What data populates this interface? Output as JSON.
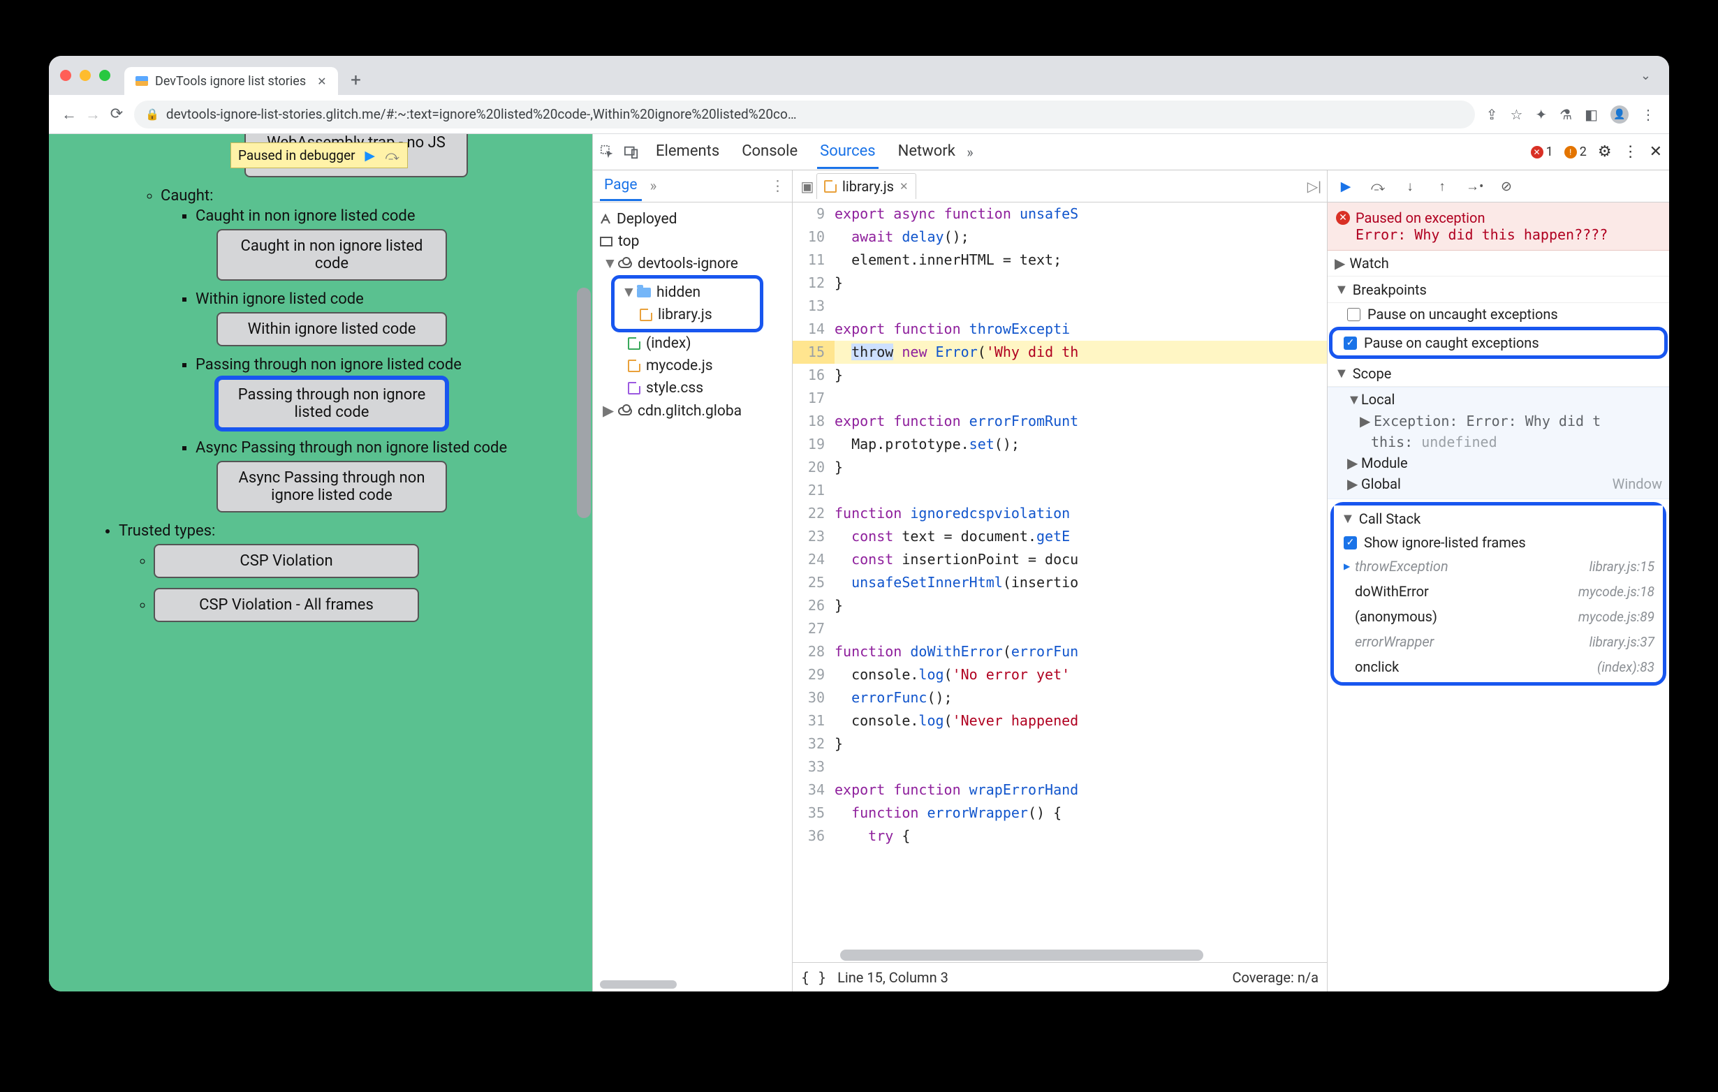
{
  "window": {
    "tab_title": "DevTools ignore list stories",
    "url": "devtools-ignore-list-stories.glitch.me/#:~:text=ignore%20listed%20code-,Within%20ignore%20listed%20co…"
  },
  "paused_overlay": {
    "label": "Paused in debugger"
  },
  "page": {
    "top_button": "WebAssembly trap - no JS frames",
    "caught_label": "Caught:",
    "items": [
      {
        "label": "Caught in non ignore listed code",
        "button": "Caught in non ignore listed code",
        "hi": false
      },
      {
        "label": "Within ignore listed code",
        "button": "Within ignore listed code",
        "hi": false
      },
      {
        "label": "Passing through non ignore listed code",
        "button": "Passing through non ignore listed code",
        "hi": true
      },
      {
        "label": "Async Passing through non ignore listed code",
        "button": "Async Passing through non ignore listed code",
        "hi": false
      }
    ],
    "trusted_label": "Trusted types:",
    "trusted_buttons": [
      "CSP Violation",
      "CSP Violation - All frames"
    ]
  },
  "devtools": {
    "tabs": [
      "Elements",
      "Console",
      "Sources",
      "Network"
    ],
    "active_tab": "Sources",
    "errors": 1,
    "warnings": 2,
    "page_tab": "Page",
    "tree": {
      "deployed": "Deployed",
      "top": "top",
      "domain": "devtools-ignore",
      "hidden": "hidden",
      "library": "library.js",
      "index": "(index)",
      "mycode": "mycode.js",
      "style": "style.css",
      "cdn": "cdn.glitch.globa"
    },
    "editor": {
      "filename": "library.js",
      "status_line": "Line 15, Column 3",
      "coverage": "Coverage: n/a",
      "lines": [
        {
          "n": 9,
          "html": "<span class='kw'>export</span> <span class='kw'>async</span> <span class='kw'>function</span> <span class='fn'>unsafeS</span>"
        },
        {
          "n": 10,
          "html": "  <span class='kw'>await</span> <span class='fn'>delay</span>();"
        },
        {
          "n": 11,
          "html": "  element.innerHTML = text;"
        },
        {
          "n": 12,
          "html": "}"
        },
        {
          "n": 13,
          "html": ""
        },
        {
          "n": 14,
          "html": "<span class='kw'>export</span> <span class='kw'>function</span> <span class='fn'>throwExcepti</span>"
        },
        {
          "n": 15,
          "html": "  <span class='sel'>throw</span> <span class='kw'>new</span> <span class='fn'>Error</span>(<span class='str'>'Why did th</span>",
          "pause": true
        },
        {
          "n": 16,
          "html": "}"
        },
        {
          "n": 17,
          "html": ""
        },
        {
          "n": 18,
          "html": "<span class='kw'>export</span> <span class='kw'>function</span> <span class='fn'>errorFromRunt</span>"
        },
        {
          "n": 19,
          "html": "  Map.prototype.<span class='fn'>set</span>();"
        },
        {
          "n": 20,
          "html": "}"
        },
        {
          "n": 21,
          "html": ""
        },
        {
          "n": 22,
          "html": "<span class='kw'>function</span> <span class='fn'>ignoredcspviolation</span>"
        },
        {
          "n": 23,
          "html": "  <span class='kw'>const</span> text = document.<span class='fn'>getE</span>"
        },
        {
          "n": 24,
          "html": "  <span class='kw'>const</span> insertionPoint = docu"
        },
        {
          "n": 25,
          "html": "  <span class='fn'>unsafeSetInnerHtml</span>(insertio"
        },
        {
          "n": 26,
          "html": "}"
        },
        {
          "n": 27,
          "html": ""
        },
        {
          "n": 28,
          "html": "<span class='kw'>function</span> <span class='fn'>doWithError</span>(<span class='par'>errorFun</span>"
        },
        {
          "n": 29,
          "html": "  console.<span class='fn'>log</span>(<span class='str'>'No error yet'</span>"
        },
        {
          "n": 30,
          "html": "  <span class='fn'>errorFunc</span>();"
        },
        {
          "n": 31,
          "html": "  console.<span class='fn'>log</span>(<span class='str'>'Never happened</span>"
        },
        {
          "n": 32,
          "html": "}"
        },
        {
          "n": 33,
          "html": ""
        },
        {
          "n": 34,
          "html": "<span class='kw'>export</span> <span class='kw'>function</span> <span class='fn'>wrapErrorHand</span>"
        },
        {
          "n": 35,
          "html": "  <span class='kw'>function</span> <span class='fn'>errorWrapper</span>() {"
        },
        {
          "n": 36,
          "html": "    <span class='kw'>try</span> {"
        }
      ]
    },
    "debugger": {
      "paused_title": "Paused on exception",
      "paused_msg": "Error: Why did this happen????",
      "sections": {
        "watch": "Watch",
        "breakpoints": "Breakpoints",
        "scope": "Scope",
        "callstack": "Call Stack"
      },
      "bp_uncaught": "Pause on uncaught exceptions",
      "bp_caught": "Pause on caught exceptions",
      "scope": {
        "local": "Local",
        "exception_label": "Exception:",
        "exception_val": "Error: Why did t",
        "this_label": "this:",
        "this_val": "undefined",
        "module": "Module",
        "global": "Global",
        "global_val": "Window"
      },
      "show_ignore": "Show ignore-listed frames",
      "frames": [
        {
          "name": "throwException",
          "loc": "library.js:15",
          "ignored": true,
          "current": true
        },
        {
          "name": "doWithError",
          "loc": "mycode.js:18",
          "ignored": false
        },
        {
          "name": "(anonymous)",
          "loc": "mycode.js:89",
          "ignored": false
        },
        {
          "name": "errorWrapper",
          "loc": "library.js:37",
          "ignored": true
        },
        {
          "name": "onclick",
          "loc": "(index):83",
          "ignored": false
        }
      ]
    }
  }
}
